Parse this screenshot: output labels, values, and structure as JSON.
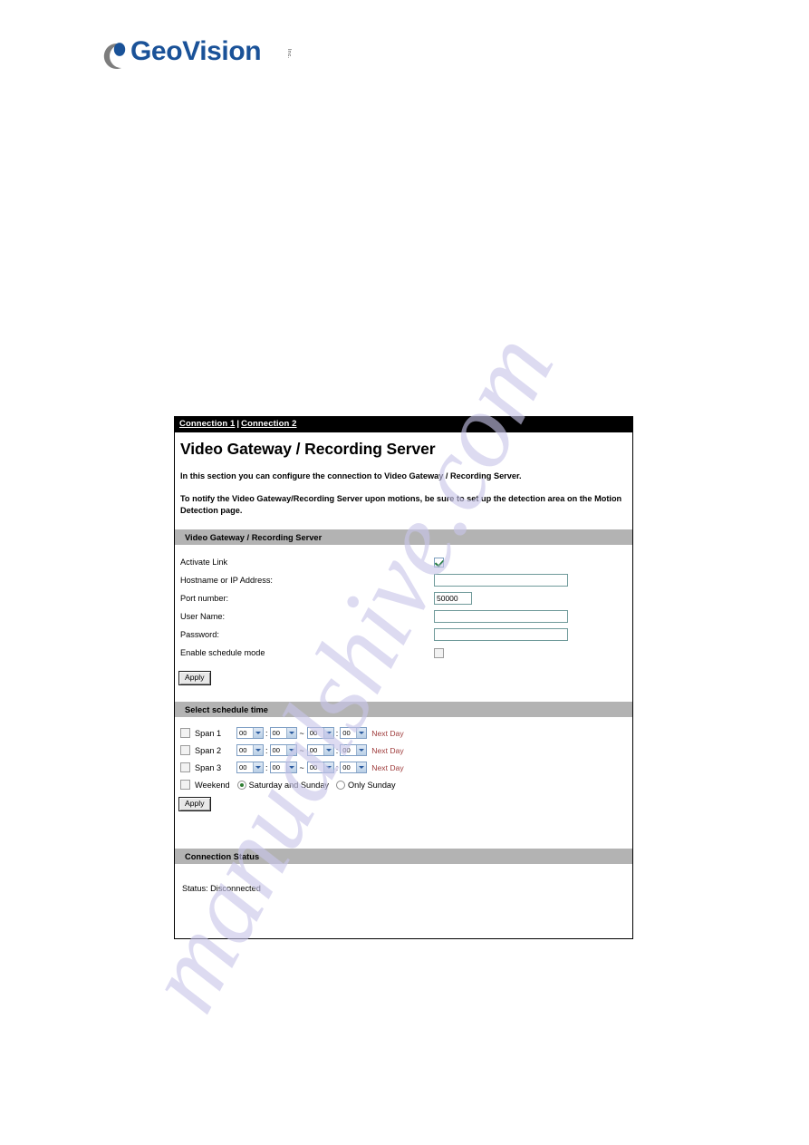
{
  "document": {
    "logo": {
      "brand": "GeoVision",
      "suffix": "Inc.",
      "icon": "geovision-crescent-logo",
      "brand_color": "#1a5298",
      "arc_color": "#7d7d7d"
    },
    "watermark": "manualshive.com"
  },
  "panel": {
    "tabs": [
      {
        "label": "Connection 1"
      },
      {
        "label": "Connection 2"
      }
    ],
    "tab_separator": "|",
    "page_title": "Video Gateway / Recording Server",
    "intro_paragraphs": [
      "In this section you can configure the connection to Video Gateway / Recording Server.",
      "To notify the Video Gateway/Recording Server upon motions, be sure to set up the detection area on the Motion Detection page."
    ],
    "server_section": {
      "header": "Video Gateway / Recording Server",
      "rows": [
        {
          "label": "Activate Link",
          "type": "checkbox",
          "checked": true
        },
        {
          "label": "Hostname or IP Address:",
          "type": "text",
          "value": "",
          "size": "wide"
        },
        {
          "label": "Port number:",
          "type": "text",
          "value": "50000",
          "size": "narrow"
        },
        {
          "label": "User Name:",
          "type": "text",
          "value": "",
          "size": "wide"
        },
        {
          "label": "Password:",
          "type": "text",
          "value": "",
          "size": "wide"
        },
        {
          "label": "Enable schedule mode",
          "type": "checkbox",
          "checked": false
        }
      ],
      "apply_label": "Apply"
    },
    "schedule_section": {
      "header": "Select schedule time",
      "spans": [
        {
          "label": "Span 1",
          "checked": false,
          "start_hour": "00",
          "start_minute": "00",
          "end_hour": "00",
          "end_minute": "00",
          "next_day_label": "Next Day"
        },
        {
          "label": "Span 2",
          "checked": false,
          "start_hour": "00",
          "start_minute": "00",
          "end_hour": "00",
          "end_minute": "00",
          "next_day_label": "Next Day"
        },
        {
          "label": "Span 3",
          "checked": false,
          "start_hour": "00",
          "start_minute": "00",
          "end_hour": "00",
          "end_minute": "00",
          "next_day_label": "Next Day"
        }
      ],
      "time_separator": ":",
      "range_separator": "~",
      "weekend": {
        "label": "Weekend",
        "checked": false,
        "options": [
          {
            "label": "Saturday and Sunday",
            "selected": true
          },
          {
            "label": "Only Sunday",
            "selected": false
          }
        ]
      },
      "apply_label": "Apply"
    },
    "status_section": {
      "header": "Connection Status",
      "status_text": "Status: Disconnected"
    },
    "colors": {
      "section_header_bg": "#b3b3b3",
      "tabbar_bg": "#000000",
      "next_day_text": "#9e3b3b",
      "input_border": "#6f9a9a"
    }
  }
}
